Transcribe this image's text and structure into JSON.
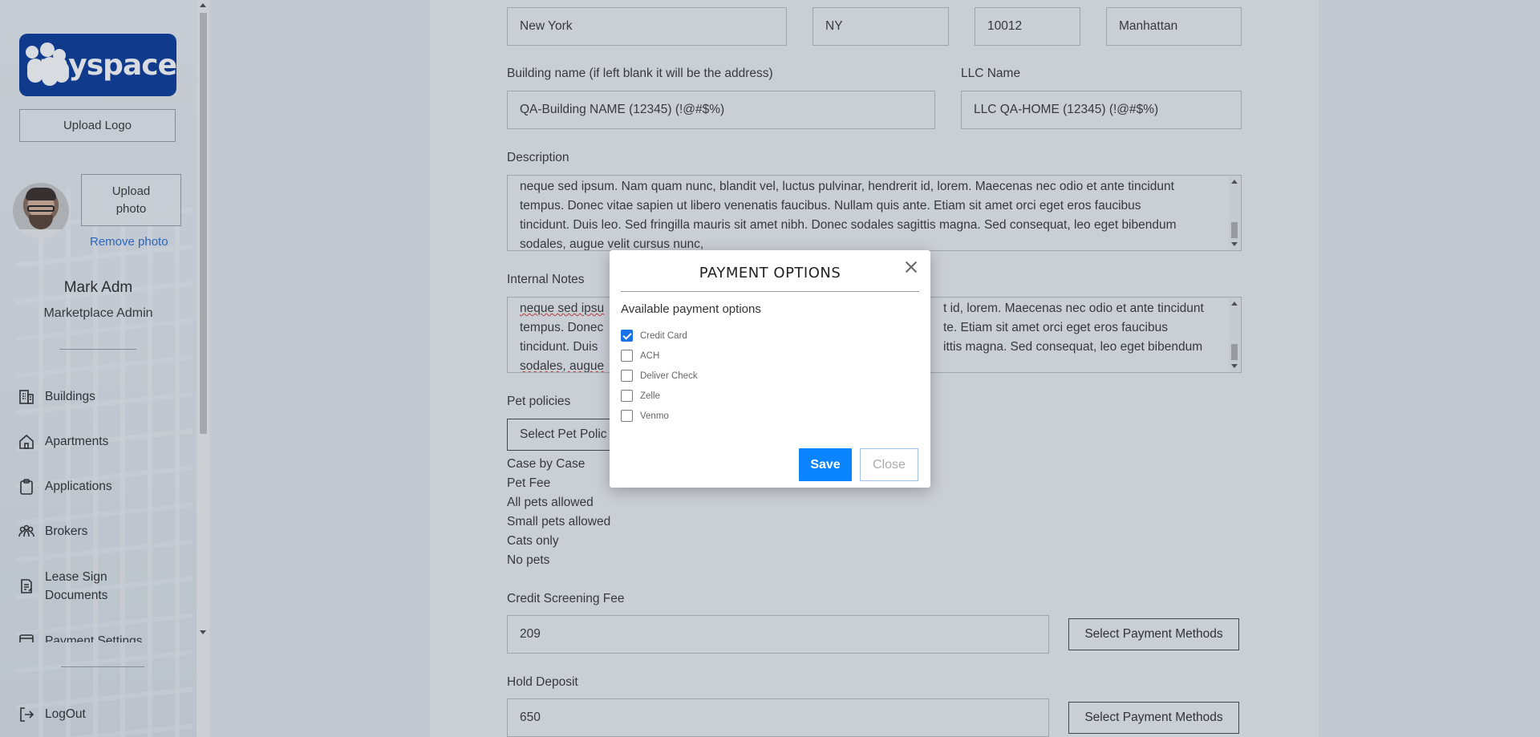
{
  "sidebar": {
    "logo_text": "myspace",
    "upload_logo": "Upload Logo",
    "upload_photo_line1": "Upload",
    "upload_photo_line2": "photo",
    "remove_photo": "Remove photo",
    "user_name": "Mark Adm",
    "user_role": "Marketplace Admin",
    "nav": [
      {
        "label": "Buildings",
        "icon": "building-icon"
      },
      {
        "label": "Apartments",
        "icon": "home-icon"
      },
      {
        "label": "Applications",
        "icon": "clipboard-icon"
      },
      {
        "label": "Brokers",
        "icon": "people-icon"
      },
      {
        "label": "Lease Sign",
        "label2": "Documents",
        "icon": "document-sign-icon"
      },
      {
        "label": "Payment Settings",
        "icon": "payment-icon"
      }
    ],
    "logout": "LogOut"
  },
  "form": {
    "city": "New York",
    "state": "NY",
    "zip": "10012",
    "neighborhood": "Manhattan",
    "building_name_label": "Building name (if left blank it will be the address)",
    "building_name": "QA-Building NAME (12345) (!@#$%)",
    "llc_label": "LLC Name",
    "llc_name": "LLC QA-HOME (12345) (!@#$%)",
    "description_label": "Description",
    "description_lines": [
      "neque sed ipsum. Nam quam nunc, blandit vel, luctus pulvinar, hendrerit id, lorem. Maecenas nec odio et ante tincidunt",
      "tempus. Donec vitae sapien ut libero venenatis faucibus. Nullam quis ante. Etiam sit amet orci eget eros faucibus",
      "tincidunt. Duis leo. Sed fringilla mauris sit amet nibh. Donec sodales sagittis magna. Sed consequat, leo eget bibendum",
      "sodales, augue velit cursus nunc,"
    ],
    "internal_notes_label": "Internal Notes",
    "notes_line1_left": "neque sed ipsu",
    "notes_line1_right": "t id, lorem. Maecenas nec odio et ante tincidunt",
    "notes_line2_left": "tempus. Donec",
    "notes_line2_right": "te. Etiam sit amet orci eget eros faucibus",
    "notes_line3_left": "tincidunt. Duis",
    "notes_line3_right": "ittis magna. Sed consequat, leo eget bibendum",
    "notes_line4_left": "sodales, augue",
    "pet_policies_label": "Pet policies",
    "pet_select": "Select Pet Polic",
    "pet_options": [
      "Case by Case",
      "Pet Fee",
      "All pets allowed",
      "Small pets allowed",
      "Cats only",
      "No pets"
    ],
    "credit_fee_label": "Credit Screening Fee",
    "credit_fee": "209",
    "hold_deposit_label": "Hold Deposit",
    "hold_deposit": "650",
    "select_payment_methods": "Select Payment Methods"
  },
  "modal": {
    "title": "PAYMENT OPTIONS",
    "subtitle": "Available payment options",
    "options": [
      {
        "label": "Credit Card",
        "checked": true
      },
      {
        "label": "ACH",
        "checked": false
      },
      {
        "label": "Deliver Check",
        "checked": false
      },
      {
        "label": "Zelle",
        "checked": false
      },
      {
        "label": "Venmo",
        "checked": false
      }
    ],
    "save": "Save",
    "close": "Close"
  },
  "colors": {
    "primary": "#0a84ff",
    "logo_bg": "#0c3c9a",
    "link": "#2f6fd0"
  }
}
